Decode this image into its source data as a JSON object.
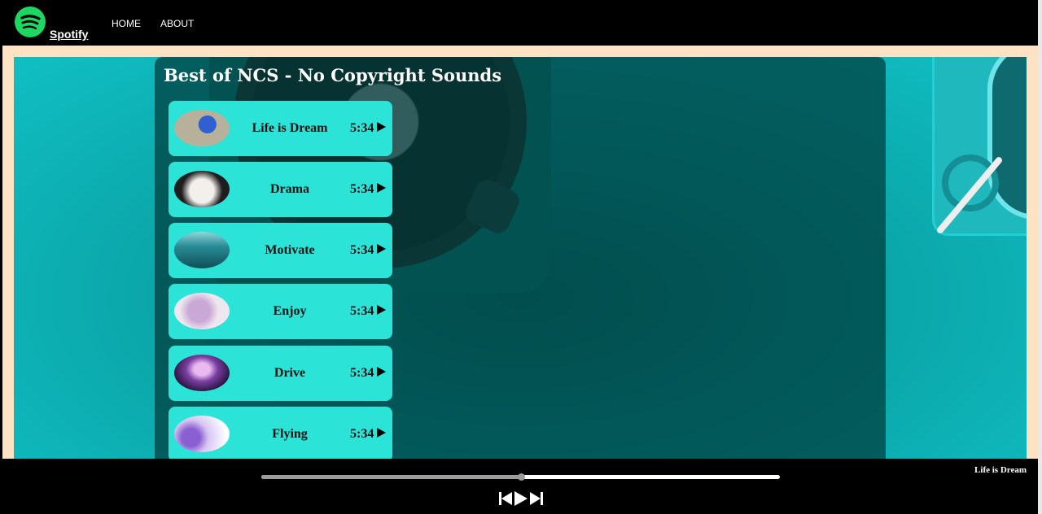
{
  "nav": {
    "brand": "Spotify",
    "links": [
      "HOME",
      "ABOUT"
    ]
  },
  "playlist": {
    "title": "Best of NCS - No Copyright Sounds",
    "songs": [
      {
        "name": "Life is Dream",
        "duration": "5:34",
        "thumb_color": "#5a78c8"
      },
      {
        "name": "Drama",
        "duration": "5:34",
        "thumb_color": "#d9d9d9"
      },
      {
        "name": "Motivate",
        "duration": "5:34",
        "thumb_color": "#1f6f78"
      },
      {
        "name": "Enjoy",
        "duration": "5:34",
        "thumb_color": "#e8d8e8"
      },
      {
        "name": "Drive",
        "duration": "5:34",
        "thumb_color": "#3a1f55"
      },
      {
        "name": "Flying",
        "duration": "5:34",
        "thumb_color": "#c7b3ea"
      }
    ]
  },
  "player": {
    "progress": 0.5,
    "now_playing": "Life is Dream",
    "controls": [
      "previous-icon",
      "play-icon",
      "next-icon"
    ]
  },
  "colors": {
    "accent": "#1ed760",
    "song_card": "#2ce3d8",
    "page_bg": "#fde3c4"
  }
}
